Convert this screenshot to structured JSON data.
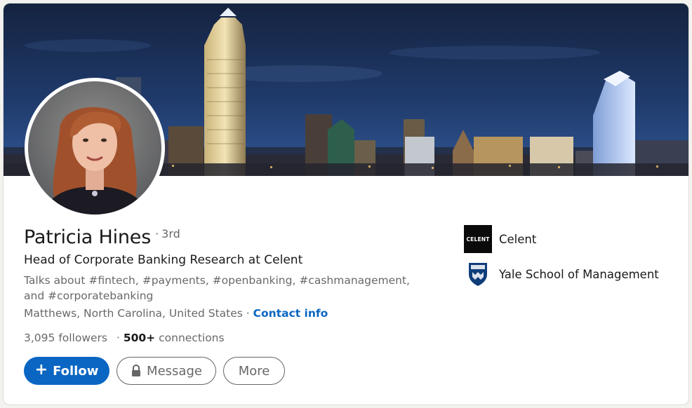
{
  "profile": {
    "name": "Patricia Hines",
    "degree_dot": "·",
    "degree": "3rd",
    "headline": "Head of Corporate Banking Research at Celent",
    "talks_about": "Talks about #fintech, #payments, #openbanking, #cashmanagement, and #corporatebanking",
    "location": "Matthews, North Carolina, United States",
    "location_sep": " · ",
    "contact_info": "Contact info",
    "followers": "3,095",
    "followers_label": "followers",
    "connections_sep": "·",
    "connections": "500+",
    "connections_label": "connections"
  },
  "actions": {
    "follow_icon": "+",
    "follow_label": "Follow",
    "message_icon": "lock-icon",
    "message_label": "Message",
    "more_label": "More"
  },
  "sidebar": {
    "items": [
      {
        "label": "Celent",
        "logo_text": "CELENT",
        "logo_icon": "celent-logo"
      },
      {
        "label": "Yale School of Management",
        "logo_icon": "yale-shield-logo"
      }
    ]
  },
  "colors": {
    "accent": "#0a66c2",
    "banner_sky": "#1b2b52"
  }
}
